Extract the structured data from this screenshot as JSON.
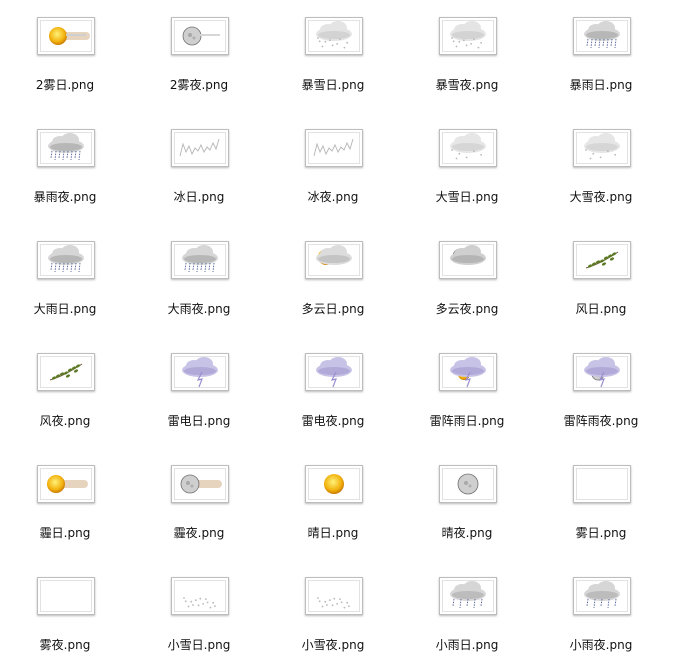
{
  "files": [
    {
      "name": "2雾日.png",
      "icon": "fog-sun-icon"
    },
    {
      "name": "2雾夜.png",
      "icon": "fog-moon-icon"
    },
    {
      "name": "暴雪日.png",
      "icon": "heavy-snow-cloud-icon"
    },
    {
      "name": "暴雪夜.png",
      "icon": "heavy-snow-cloud-icon"
    },
    {
      "name": "暴雨日.png",
      "icon": "rain-cloud-icon"
    },
    {
      "name": "暴雨夜.png",
      "icon": "rain-cloud-icon"
    },
    {
      "name": "冰日.png",
      "icon": "ice-icon"
    },
    {
      "name": "冰夜.png",
      "icon": "ice-icon"
    },
    {
      "name": "大雪日.png",
      "icon": "snow-cloud-icon"
    },
    {
      "name": "大雪夜.png",
      "icon": "snow-cloud-icon"
    },
    {
      "name": "大雨日.png",
      "icon": "rain-cloud-icon"
    },
    {
      "name": "大雨夜.png",
      "icon": "rain-cloud-icon"
    },
    {
      "name": "多云日.png",
      "icon": "cloudy-sun-icon"
    },
    {
      "name": "多云夜.png",
      "icon": "cloudy-moon-icon"
    },
    {
      "name": "风日.png",
      "icon": "wind-leaves-icon"
    },
    {
      "name": "风夜.png",
      "icon": "wind-leaves-icon"
    },
    {
      "name": "雷电日.png",
      "icon": "thunder-cloud-icon"
    },
    {
      "name": "雷电夜.png",
      "icon": "thunder-cloud-icon"
    },
    {
      "name": "雷阵雨日.png",
      "icon": "thunder-shower-sun-icon"
    },
    {
      "name": "雷阵雨夜.png",
      "icon": "thunder-shower-moon-icon"
    },
    {
      "name": "霾日.png",
      "icon": "haze-sun-icon"
    },
    {
      "name": "霾夜.png",
      "icon": "haze-moon-icon"
    },
    {
      "name": "晴日.png",
      "icon": "sun-icon"
    },
    {
      "name": "晴夜.png",
      "icon": "moon-icon"
    },
    {
      "name": "雾日.png",
      "icon": "blank-icon"
    },
    {
      "name": "雾夜.png",
      "icon": "blank-icon"
    },
    {
      "name": "小雪日.png",
      "icon": "light-snow-icon"
    },
    {
      "name": "小雪夜.png",
      "icon": "light-snow-icon"
    },
    {
      "name": "小雨日.png",
      "icon": "light-rain-cloud-icon"
    },
    {
      "name": "小雨夜.png",
      "icon": "light-rain-cloud-icon"
    }
  ],
  "colors": {
    "sun": "#f2b10c",
    "moon": "#8e8e8e",
    "cloud": "#d6d6d6",
    "rain": "#5b6a9c",
    "thunder": "#9a8fd0",
    "leaf": "#5b7a22"
  }
}
